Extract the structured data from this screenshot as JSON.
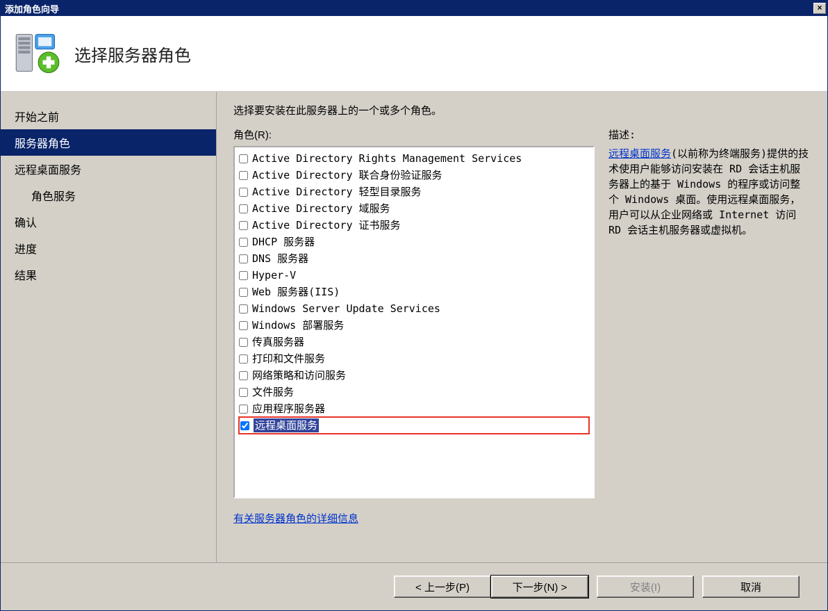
{
  "titlebar": {
    "title": "添加角色向导",
    "close_symbol": "×"
  },
  "header": {
    "title": "选择服务器角色"
  },
  "sidebar": {
    "items": [
      {
        "label": "开始之前",
        "indent": false,
        "selected": false
      },
      {
        "label": "服务器角色",
        "indent": false,
        "selected": true
      },
      {
        "label": "远程桌面服务",
        "indent": false,
        "selected": false
      },
      {
        "label": "角色服务",
        "indent": true,
        "selected": false
      },
      {
        "label": "确认",
        "indent": false,
        "selected": false
      },
      {
        "label": "进度",
        "indent": false,
        "selected": false
      },
      {
        "label": "结果",
        "indent": false,
        "selected": false
      }
    ]
  },
  "content": {
    "instruction": "选择要安装在此服务器上的一个或多个角色。",
    "roles_label": "角色(R):",
    "roles": [
      {
        "label": "Active Directory Rights Management Services",
        "checked": false,
        "selected": false,
        "highlighted": false
      },
      {
        "label": "Active Directory 联合身份验证服务",
        "checked": false,
        "selected": false,
        "highlighted": false
      },
      {
        "label": "Active Directory 轻型目录服务",
        "checked": false,
        "selected": false,
        "highlighted": false
      },
      {
        "label": "Active Directory 域服务",
        "checked": false,
        "selected": false,
        "highlighted": false
      },
      {
        "label": "Active Directory 证书服务",
        "checked": false,
        "selected": false,
        "highlighted": false
      },
      {
        "label": "DHCP 服务器",
        "checked": false,
        "selected": false,
        "highlighted": false
      },
      {
        "label": "DNS 服务器",
        "checked": false,
        "selected": false,
        "highlighted": false
      },
      {
        "label": "Hyper-V",
        "checked": false,
        "selected": false,
        "highlighted": false
      },
      {
        "label": "Web 服务器(IIS)",
        "checked": false,
        "selected": false,
        "highlighted": false
      },
      {
        "label": "Windows Server Update Services",
        "checked": false,
        "selected": false,
        "highlighted": false
      },
      {
        "label": "Windows 部署服务",
        "checked": false,
        "selected": false,
        "highlighted": false
      },
      {
        "label": "传真服务器",
        "checked": false,
        "selected": false,
        "highlighted": false
      },
      {
        "label": "打印和文件服务",
        "checked": false,
        "selected": false,
        "highlighted": false
      },
      {
        "label": "网络策略和访问服务",
        "checked": false,
        "selected": false,
        "highlighted": false
      },
      {
        "label": "文件服务",
        "checked": false,
        "selected": false,
        "highlighted": false
      },
      {
        "label": "应用程序服务器",
        "checked": false,
        "selected": false,
        "highlighted": false
      },
      {
        "label": "远程桌面服务",
        "checked": true,
        "selected": true,
        "highlighted": true
      }
    ],
    "more_link": "有关服务器角色的详细信息",
    "description": {
      "label": "描述:",
      "link_text": "远程桌面服务",
      "body": "(以前称为终端服务)提供的技术使用户能够访问安装在 RD 会话主机服务器上的基于 Windows 的程序或访问整个 Windows 桌面。使用远程桌面服务，用户可以从企业网络或 Internet 访问 RD 会话主机服务器或虚拟机。"
    }
  },
  "footer": {
    "back": "< 上一步(P)",
    "next": "下一步(N) >",
    "install": "安装(I)",
    "cancel": "取消"
  },
  "colors": {
    "titlebar_bg": "#0a246a",
    "selection_bg": "#31449b",
    "sidebar_sel_bg": "#0a246a",
    "link_color": "#0033cc",
    "highlight_red": "#e83227"
  }
}
